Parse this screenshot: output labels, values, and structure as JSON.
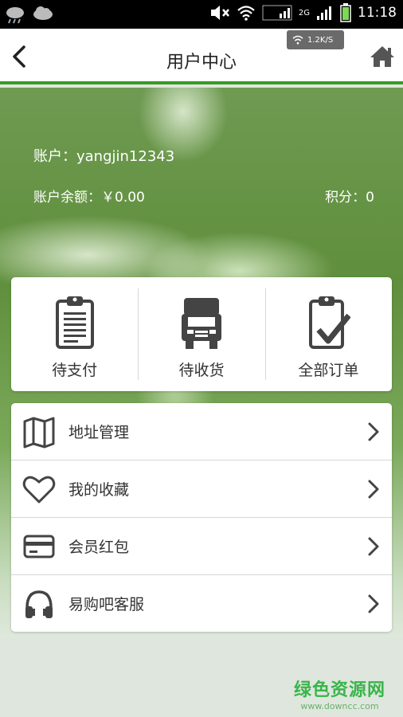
{
  "status_bar": {
    "time": "11:18",
    "network_label": "2G",
    "speed": "1.2K/S"
  },
  "header": {
    "title": "用户中心"
  },
  "account": {
    "account_text": "账户：yangjin12343",
    "balance_text": "账户余额：￥0.00",
    "points_text": "积分：0"
  },
  "orders": [
    {
      "label": "待支付",
      "icon": "clipboard-list-icon"
    },
    {
      "label": "待收货",
      "icon": "truck-icon"
    },
    {
      "label": "全部订单",
      "icon": "clipboard-check-icon"
    }
  ],
  "menu": [
    {
      "label": "地址管理",
      "icon": "map-icon"
    },
    {
      "label": "我的收藏",
      "icon": "heart-icon"
    },
    {
      "label": "会员红包",
      "icon": "card-icon"
    },
    {
      "label": "易购吧客服",
      "icon": "headphones-icon"
    }
  ],
  "watermark": {
    "title": "绿色资源网",
    "url": "www.downcc.com"
  },
  "colors": {
    "accent": "#3a9a24",
    "watermark": "#39b54a"
  }
}
